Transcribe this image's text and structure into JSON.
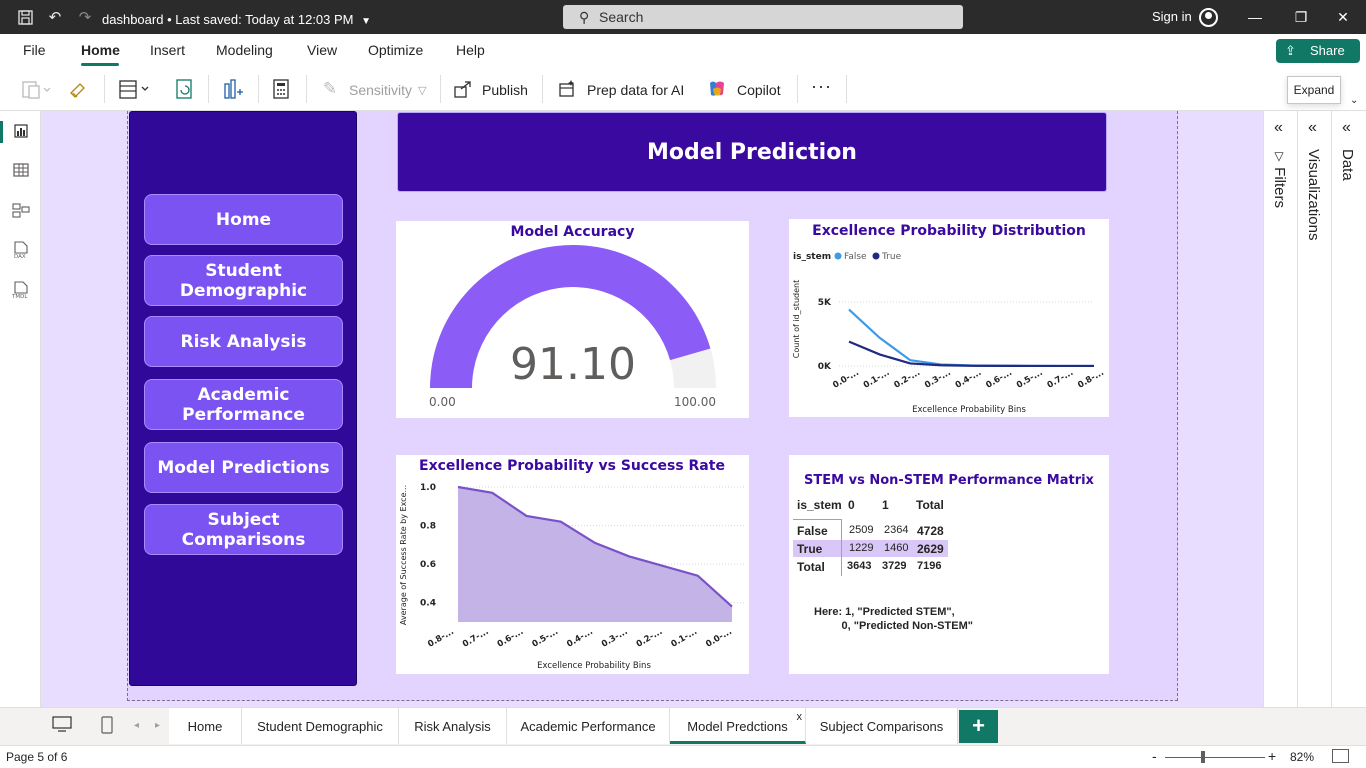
{
  "window": {
    "file_title": "dashboard",
    "saved_status": "• Last saved: Today at 12:03 PM",
    "search_placeholder": "Search",
    "sign_in": "Sign in"
  },
  "menu": {
    "items": [
      "File",
      "Home",
      "Insert",
      "Modeling",
      "View",
      "Optimize",
      "Help"
    ],
    "active": "Home",
    "share_label": "Share"
  },
  "ribbon": {
    "sensitivity": "Sensitivity",
    "publish": "Publish",
    "prep_data": "Prep data for AI",
    "copilot": "Copilot",
    "expand_tooltip": "Expand"
  },
  "report": {
    "header_title": "Model Prediction",
    "nav_buttons": [
      "Home",
      "Student Demographic",
      "Risk Analysis",
      "Academic Performance",
      "Model Predictions",
      "Subject Comparisons"
    ],
    "gauge": {
      "title": "Model Accuracy",
      "value_text": "91.10",
      "value": 91.1,
      "min_label": "0.00",
      "max_label": "100.00",
      "min": 0,
      "max": 100,
      "fill_color": "#8b5cf6",
      "track_color": "#f1f1f1"
    },
    "matrix": {
      "title": "STEM vs Non-STEM Performance Matrix",
      "headers": [
        "is_stem",
        "0",
        "1",
        "Total"
      ],
      "rows": [
        {
          "label": "False",
          "c0": "2509",
          "c1": "2364",
          "total": "4728"
        },
        {
          "label": "True",
          "c0": "1229",
          "c1": "1460",
          "total": "2629"
        },
        {
          "label": "Total",
          "c0": "3643",
          "c1": "3729",
          "total": "7196"
        }
      ],
      "note": "Here: 1, \"Predicted STEM\",\n         0, \"Predicted Non-STEM\""
    }
  },
  "chart_data": [
    {
      "type": "line",
      "title": "Excellence Probability Distribution",
      "xlabel": "Excellence Probability Bins",
      "ylabel": "Count of id_student",
      "legend_title": "is_stem",
      "legend_position": "top-left",
      "categories": [
        "0.0-...",
        "0.1-...",
        "0.2-...",
        "0.3-...",
        "0.4-...",
        "0.6-...",
        "0.5-...",
        "0.7-...",
        "0.8-..."
      ],
      "yticks": [
        "5K",
        "0K"
      ],
      "ylim": [
        0,
        6000
      ],
      "series": [
        {
          "name": "False",
          "color": "#3c9be8",
          "values": [
            4400,
            2200,
            450,
            120,
            40,
            20,
            10,
            5,
            5
          ]
        },
        {
          "name": "True",
          "color": "#1f2a80",
          "values": [
            1900,
            900,
            200,
            60,
            20,
            10,
            5,
            5,
            5
          ]
        }
      ]
    },
    {
      "type": "area",
      "title": "Excellence Probability vs Success Rate",
      "xlabel": "Excellence Probability Bins",
      "ylabel": "Average of Success Rate by Exce...",
      "categories": [
        "0.8-...",
        "0.7-...",
        "0.6-...",
        "0.5-...",
        "0.4-...",
        "0.3-...",
        "0.2-...",
        "0.1-...",
        "0.0-..."
      ],
      "yticks": [
        "1.0",
        "0.8",
        "0.6",
        "0.4"
      ],
      "ylim": [
        0.3,
        1.0
      ],
      "color": "#7a52c8",
      "fill": "#c4b3e6",
      "values": [
        1.0,
        0.97,
        0.85,
        0.82,
        0.71,
        0.64,
        0.59,
        0.54,
        0.38
      ]
    }
  ],
  "tabs": {
    "items": [
      "Home",
      "Student Demographic",
      "Risk Analysis",
      "Academic Performance",
      "Model Predctions",
      "Subject Comparisons"
    ],
    "active": "Model Predctions"
  },
  "status": {
    "page_indicator": "Page 5 of 6",
    "zoom": "82%"
  },
  "panes": {
    "filters": "Filters",
    "visualizations": "Visualizations",
    "data": "Data"
  }
}
